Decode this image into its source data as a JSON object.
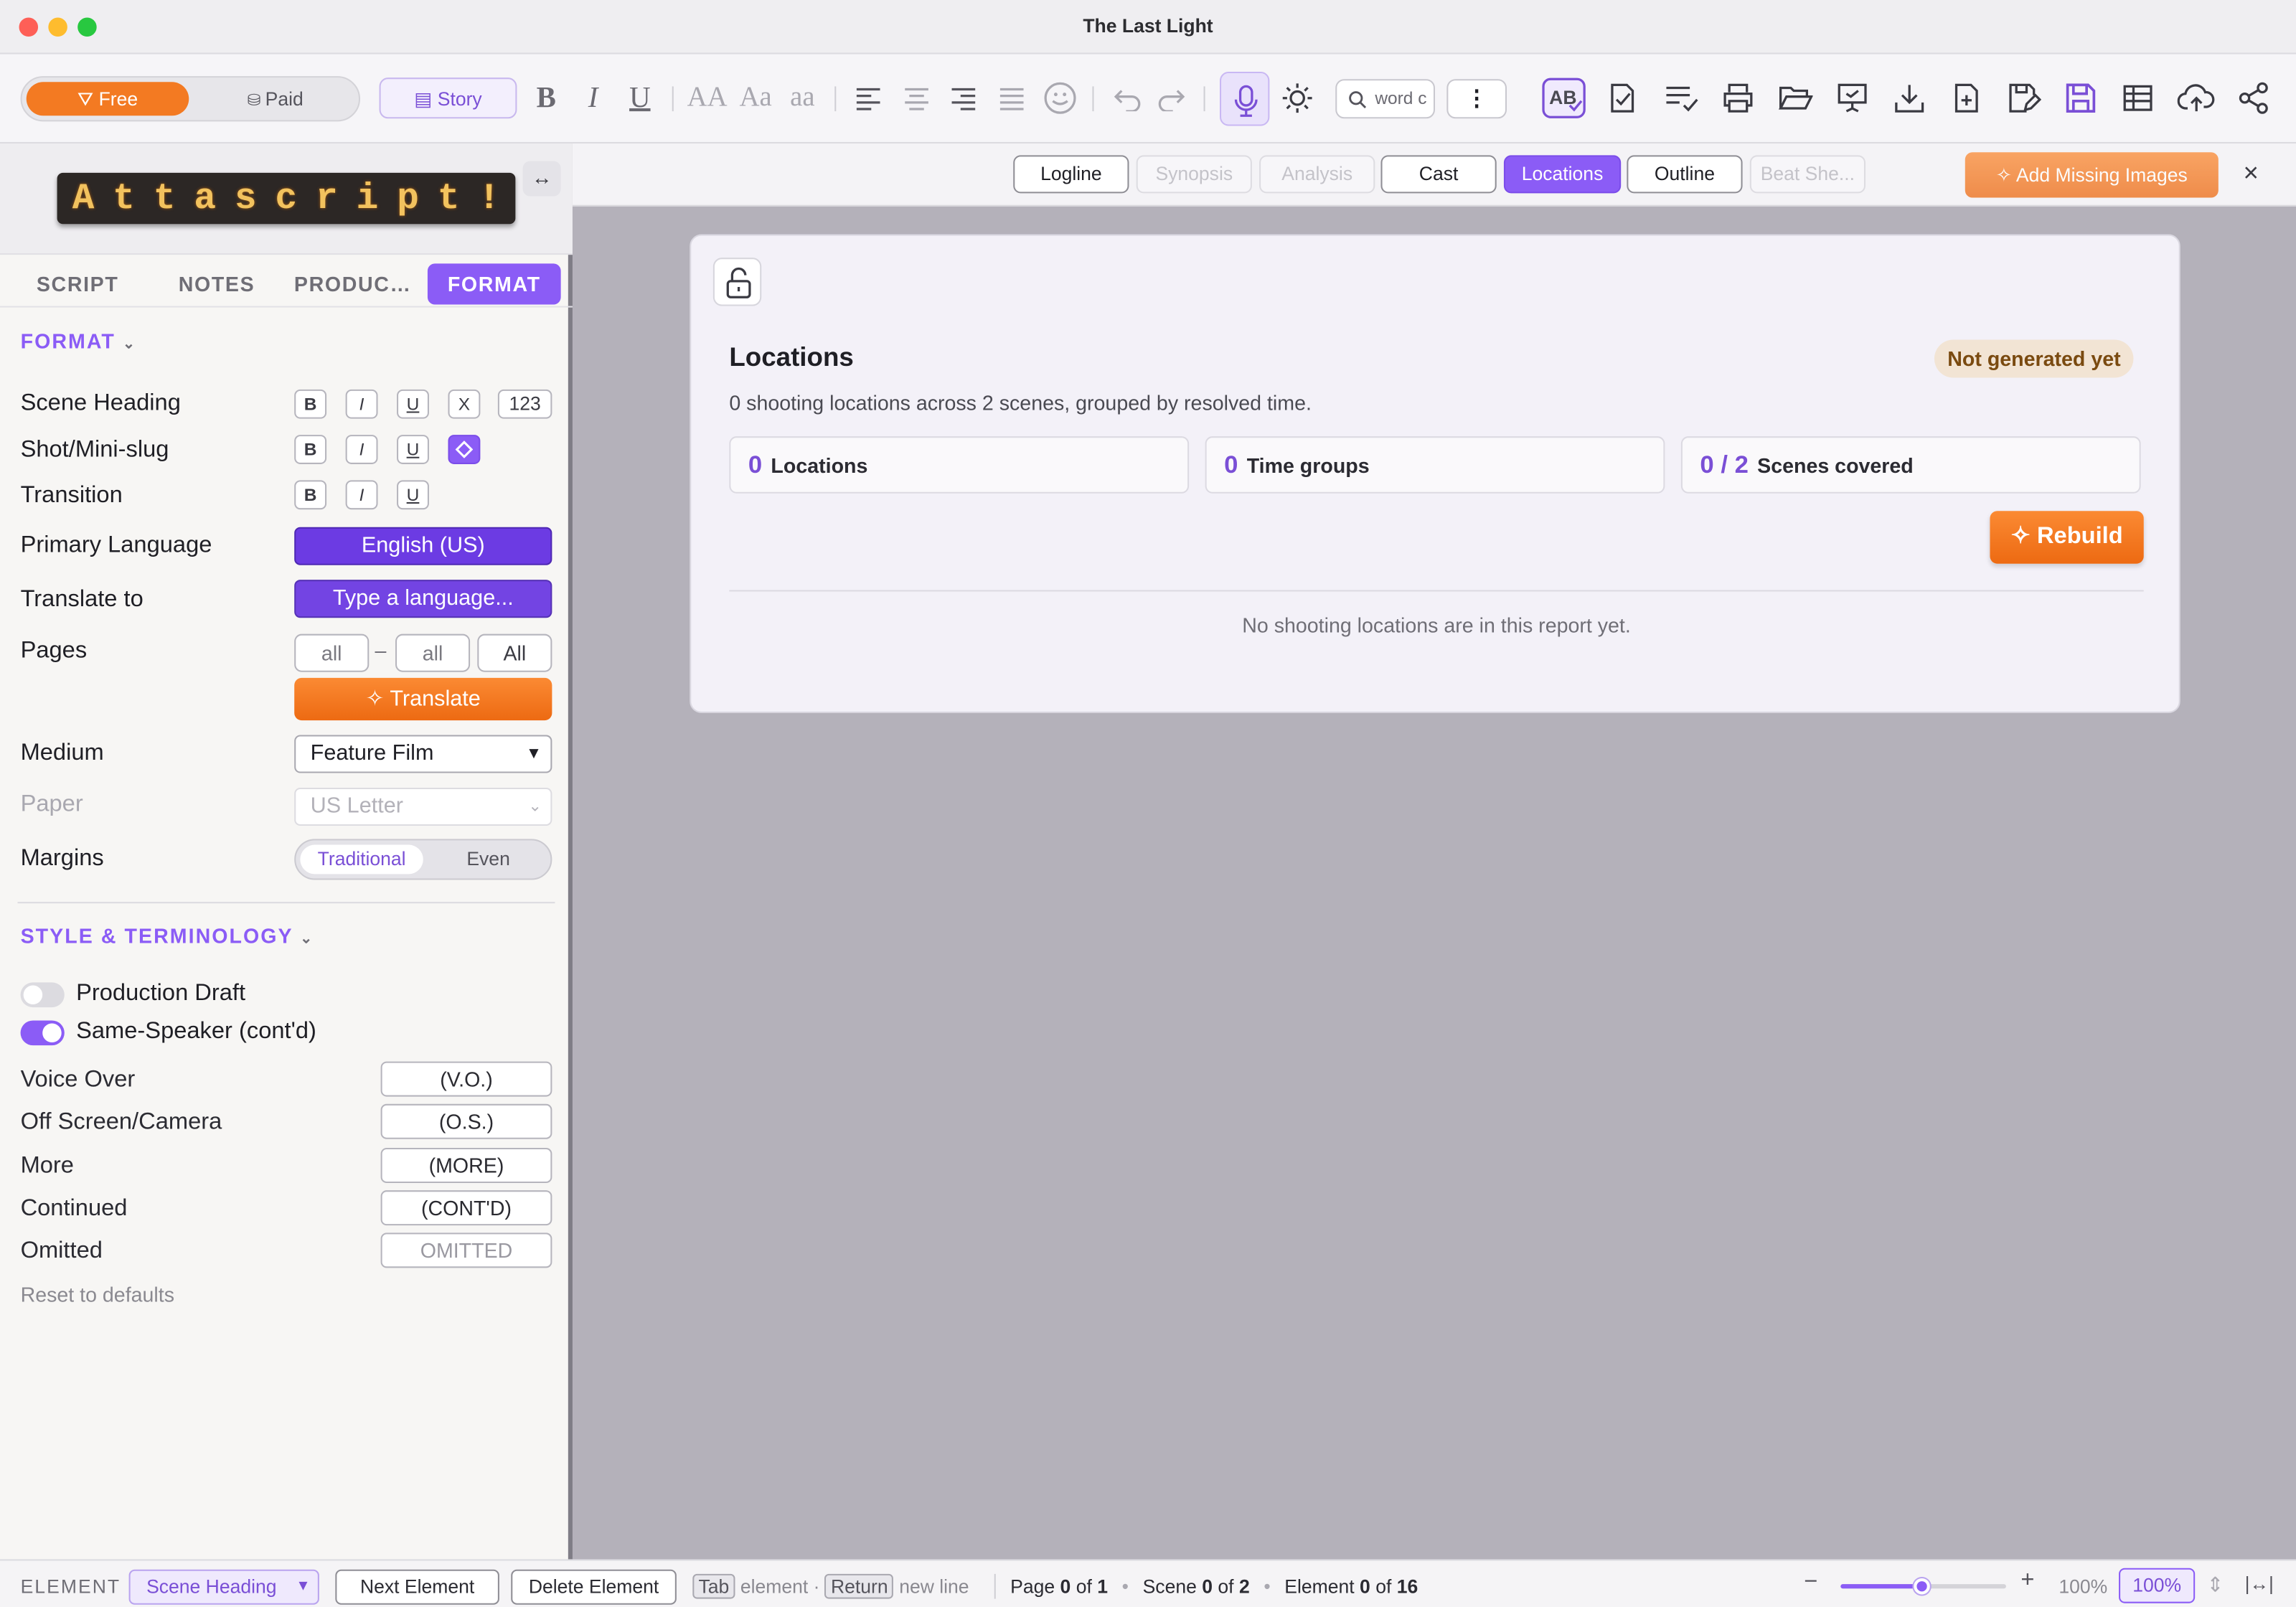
{
  "window": {
    "title": "The Last Light"
  },
  "toolbar": {
    "free_label": "Free",
    "paid_label": "Paid",
    "story_label": "Story",
    "bold": "B",
    "italic": "I",
    "underline": "U",
    "case_upper": "AA",
    "case_title": "Aa",
    "case_lower": "aa",
    "search_placeholder": "word c"
  },
  "sidebar": {
    "tabs": [
      "SCRIPT",
      "NOTES",
      "PRODUC…",
      "FORMAT"
    ],
    "format_header": "FORMAT",
    "rows": {
      "scene_heading": "Scene Heading",
      "shot": "Shot/Mini-slug",
      "transition": "Transition",
      "primary_language": "Primary Language",
      "translate_to": "Translate to",
      "pages": "Pages",
      "medium": "Medium",
      "paper": "Paper",
      "margins": "Margins"
    },
    "fmt_b": "B",
    "fmt_i": "I",
    "fmt_u": "U",
    "fmt_x": "X",
    "fmt_num": "123",
    "primary_language_value": "English (US)",
    "translate_placeholder": "Type a language...",
    "pages_from": "all",
    "pages_dash": "–",
    "pages_to": "all",
    "pages_all": "All",
    "translate_button": "Translate",
    "medium_value": "Feature Film",
    "paper_value": "US Letter",
    "margins_traditional": "Traditional",
    "margins_even": "Even",
    "style_header": "STYLE & TERMINOLOGY",
    "production_draft": "Production Draft",
    "same_speaker": "Same-Speaker (cont'd)",
    "terms": [
      {
        "label": "Voice Over",
        "value": "(V.O.)"
      },
      {
        "label": "Off Screen/Camera",
        "value": "(O.S.)"
      },
      {
        "label": "More",
        "value": "(MORE)"
      },
      {
        "label": "Continued",
        "value": "(CONT'D)"
      },
      {
        "label": "Omitted",
        "value": "OMITTED"
      }
    ],
    "reset": "Reset to defaults"
  },
  "report_tabs": [
    "Logline",
    "Synopsis",
    "Analysis",
    "Cast",
    "Locations",
    "Outline",
    "Beat She..."
  ],
  "add_missing_images": "Add Missing Images",
  "close": "×",
  "card": {
    "title": "Locations",
    "badge": "Not generated yet",
    "subtitle": "0 shooting locations across 2 scenes, grouped by resolved time.",
    "stats": [
      {
        "value": "0",
        "label": "Locations"
      },
      {
        "value": "0",
        "label": "Time groups"
      },
      {
        "value": "0 / 2",
        "label": "Scenes covered"
      }
    ],
    "rebuild": "Rebuild",
    "empty": "No shooting locations are in this report yet."
  },
  "status": {
    "element_label": "ELEMENT",
    "element_value": "Scene Heading",
    "next_element": "Next Element",
    "delete_element": "Delete Element",
    "tab_key": "Tab",
    "tab_hint": "element ·",
    "return_key": "Return",
    "return_hint": "new line",
    "page_label": "Page",
    "page_current": "0",
    "page_of": "of",
    "page_total": "1",
    "scene_label": "Scene",
    "scene_current": "0",
    "scene_of": "of",
    "scene_total": "2",
    "element_label2": "Element",
    "element_current": "0",
    "element_of": "of",
    "element_total": "16",
    "zoom_text": "100%",
    "zoom_box": "100%",
    "zoom_level": 0.5
  },
  "colors": {
    "accent": "#8b5cf6",
    "orange": "#f37a22"
  }
}
